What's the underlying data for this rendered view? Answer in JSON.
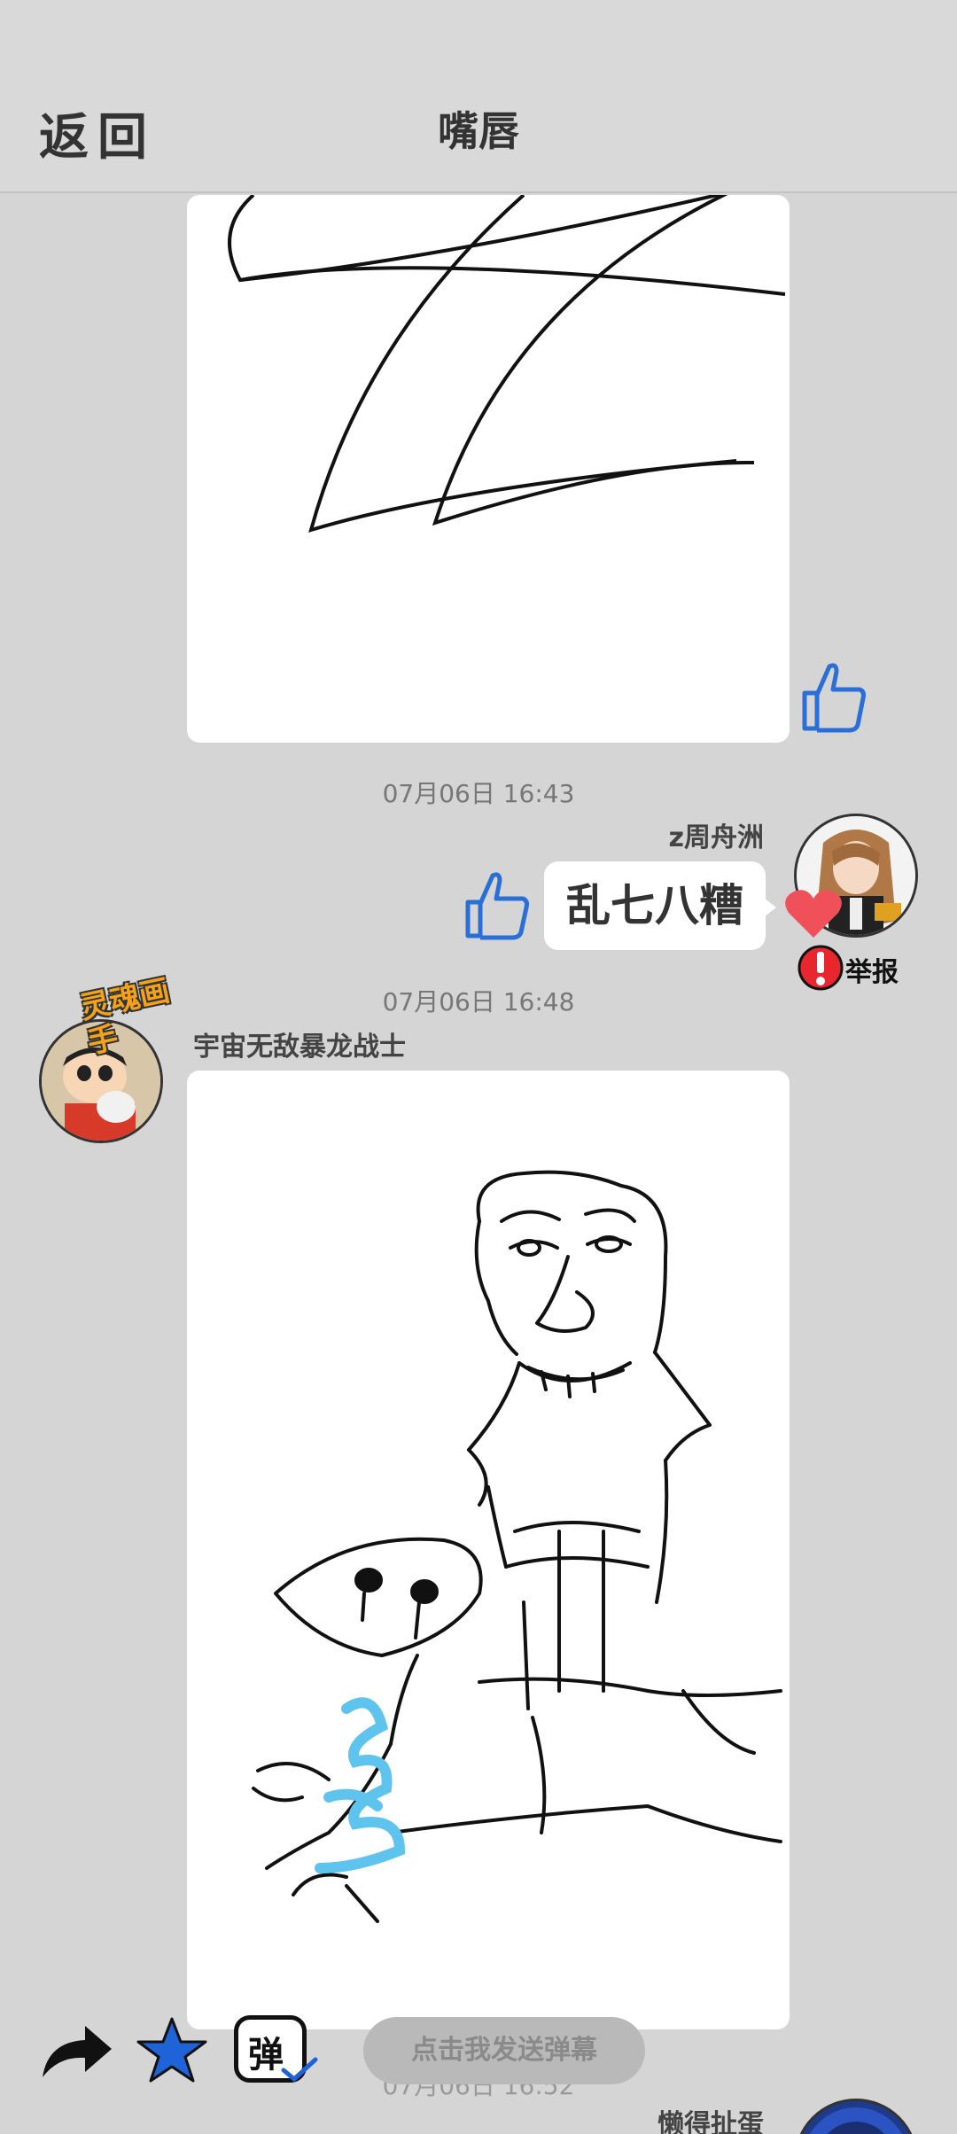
{
  "header": {
    "back_label": "返回",
    "title": "嘴唇"
  },
  "messages": [
    {
      "timestamp": "07月06日 16:43",
      "author": "z周舟洲",
      "text": "乱七八糟",
      "report_label": "举报"
    },
    {
      "timestamp": "07月06日 16:48",
      "author": "宇宙无敌暴龙战士",
      "avatar_badge": "灵魂画手"
    },
    {
      "timestamp": "07月06日 16:52",
      "author": "懒得扯蛋"
    }
  ],
  "bottom_bar": {
    "danmaku_icon_text": "弹",
    "danmaku_placeholder": "点击我发送弹幕"
  },
  "colors": {
    "background": "#d5d5d5",
    "like_blue": "#2a6fd6",
    "heart_red": "#f0505a",
    "report_red": "#e8262e",
    "star_blue": "#1f63d8"
  }
}
